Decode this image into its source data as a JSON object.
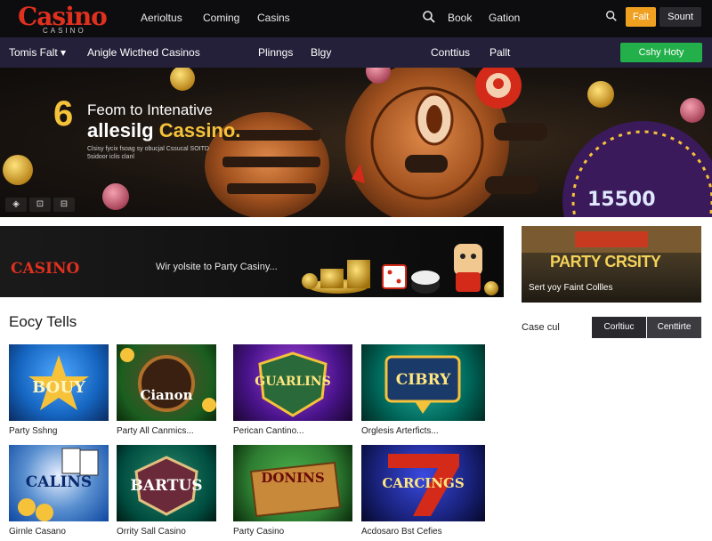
{
  "header": {
    "logo": "Casino",
    "logo_sub": "CASINO",
    "nav": [
      "Aerioltus",
      "Coming",
      "Casins"
    ],
    "right_links": [
      "Book",
      "Gation"
    ],
    "btn_orange": "Falt",
    "btn_dark": "Sount"
  },
  "subnav": {
    "dropdown": "Tomis Falt",
    "items": [
      "Anigle Wicthed Casinos",
      "Plinngs",
      "Blgy",
      "Conttius",
      "Pallt"
    ],
    "cta": "Cshy Hoty"
  },
  "hero": {
    "number": "6",
    "line1": "Feom to Intenative",
    "line2_a": "allesilg ",
    "line2_b": "Cassino.",
    "subtext": "Clsisy fycix fsoag sy obucjal Cssucal SOITD 5sidoor iclis clanl",
    "reel_text": "15500",
    "controls": [
      "◈",
      "⊡",
      "⊟"
    ]
  },
  "promo": {
    "logo": "CASINO",
    "text": "Wir yolsite to Party Casiny..."
  },
  "party": {
    "title": "PARTY CRSITY",
    "subtitle": "Sert yoy Faint Collles"
  },
  "section": {
    "title": "Eocy Tells"
  },
  "side": {
    "label": "Case cul",
    "tabs": [
      "Corltiuc",
      "Centtirte"
    ]
  },
  "games": [
    {
      "title": "BOUY",
      "label": "Party Sshng",
      "bg": "#1565c0"
    },
    {
      "title": "Cianon",
      "label": "Party All Canmics...",
      "bg": "#1b5e20"
    },
    {
      "title": "GUARLINS",
      "label": "Perican Cantino...",
      "bg": "#4a148c"
    },
    {
      "title": "CIBRY",
      "label": "Orglesis Arterficts...",
      "bg": "#00695c"
    },
    {
      "title": "CALINS",
      "label": "Girnle Casano",
      "bg": "#0d47a1"
    },
    {
      "title": "BARTUS",
      "label": "Orrity Sall Casino",
      "bg": "#004d40"
    },
    {
      "title": "DONINS",
      "label": "Party Casino",
      "bg": "#2e7d32"
    },
    {
      "title": "CARCINGS",
      "label": "Acdosaro Bst Cefies",
      "bg": "#1a237e"
    }
  ],
  "colors": {
    "accent_gold": "#f5c23a",
    "brand_red": "#e0301e",
    "cta_green": "#23b04a",
    "cta_orange": "#f0a020",
    "nav_purple": "#24203a"
  }
}
